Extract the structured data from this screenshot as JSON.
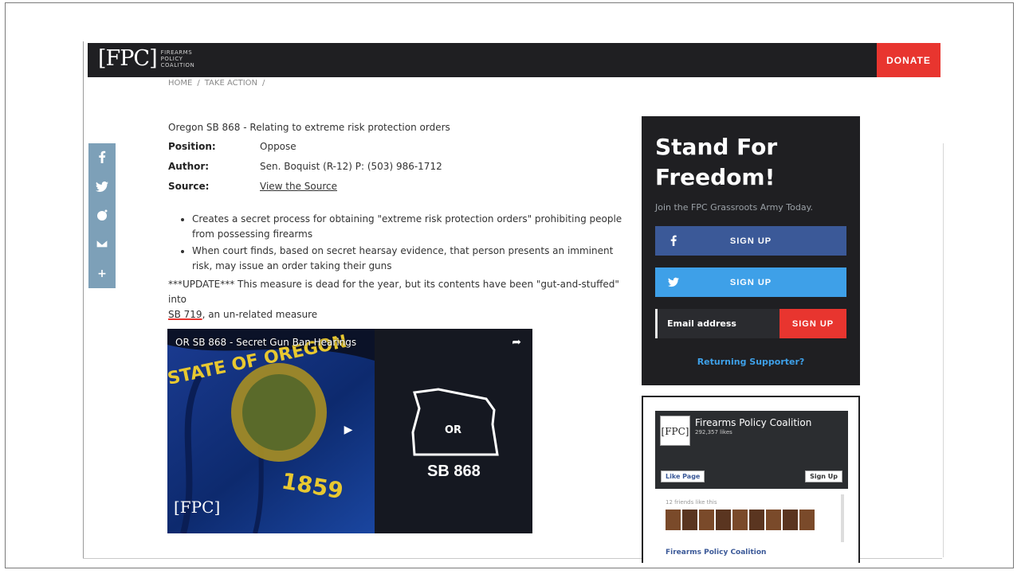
{
  "header": {
    "logo_mark": "[FPC]",
    "logo_text": "FIREARMS POLICY COALITION",
    "donate_label": "DONATE"
  },
  "breadcrumb": {
    "home": "HOME",
    "sep1": "/",
    "take_action": "TAKE ACTION",
    "sep2": "/"
  },
  "share_icons": [
    "facebook-icon",
    "twitter-icon",
    "reddit-icon",
    "email-icon",
    "plus-icon"
  ],
  "article": {
    "title": "Oregon SB 868 - Relating to extreme risk protection orders",
    "position_label": "Position:",
    "position_value": "Oppose",
    "author_label": "Author:",
    "author_value": "Sen. Boquist (R-12) P: (503) 986-1712",
    "source_label": "Source:",
    "source_link": "View the Source",
    "bullets": [
      "Creates a secret process for obtaining \"extreme risk protection orders\" prohibiting people from possessing firearms",
      "When court finds, based on secret hearsay evidence, that person presents an imminent risk, may issue an order taking their guns"
    ],
    "update_prefix": "***UPDATE*** This measure is dead for the year, but its contents have been \"gut-and-stuffed\" into",
    "update_link": "SB 719",
    "update_suffix": ", an un-related measure"
  },
  "video": {
    "title": "OR SB 868 - Secret Gun Ban Hearings",
    "banner_text": "STATE OF OREGON",
    "year_text": "1859",
    "state_label": "OR",
    "bill_label": "SB 868",
    "watermark": "[FPC]"
  },
  "signup": {
    "heading": "Stand For Freedom!",
    "subtext": "Join the FPC Grassroots Army Today.",
    "facebook_label": "SIGN UP",
    "twitter_label": "SIGN UP",
    "email_placeholder": "Email address",
    "email_button": "SIGN UP",
    "returning_label": "Returning Supporter?"
  },
  "fb_widget": {
    "logo": "[FPC]",
    "page_name": "Firearms Policy Coalition",
    "likes": "292,357 likes",
    "like_button": "Like Page",
    "signup_button": "Sign Up",
    "friends_text": "12 friends like this",
    "footer_text": "Firearms Policy Coalition"
  },
  "colors": {
    "topbar": "#1f1f22",
    "accent_red": "#e8352f",
    "facebook_blue": "#3b5998",
    "twitter_blue": "#3ea0e8",
    "share_bar": "#7da0b8"
  }
}
